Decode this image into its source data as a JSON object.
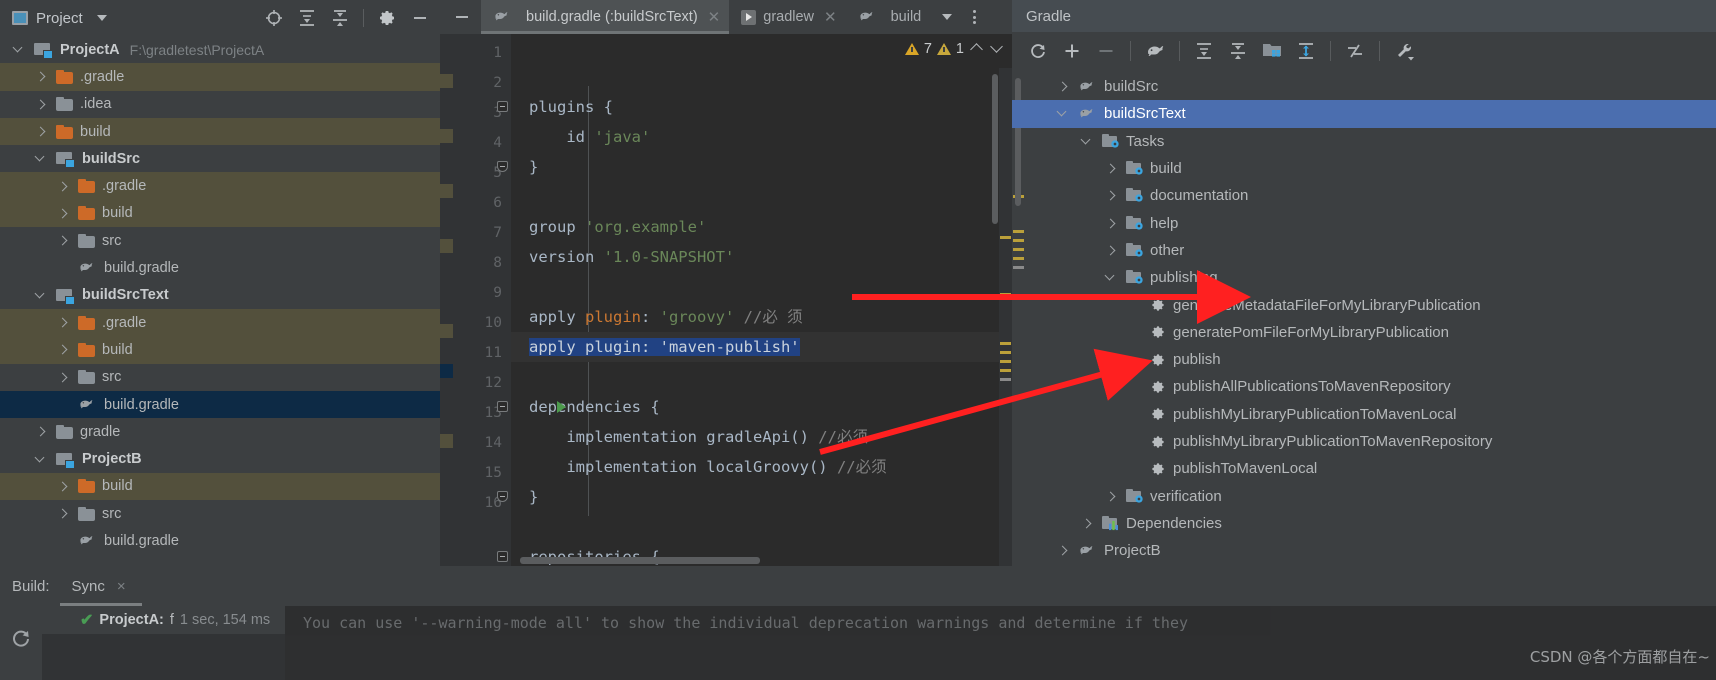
{
  "project_panel": {
    "title": "Project",
    "toolbar_icons": [
      "locate-icon",
      "expand-all-icon",
      "collapse-all-icon",
      "settings-gear-icon",
      "minimize-icon"
    ],
    "tree": [
      {
        "label": "ProjectA",
        "path": "F:\\gradletest\\ProjectA",
        "indent": 0,
        "arrow": "down",
        "icon": "module-folder-icon",
        "bold": true,
        "row_style": "dark"
      },
      {
        "label": ".gradle",
        "indent": 1,
        "arrow": "right",
        "icon": "folder-orange-icon",
        "row_style": "brown"
      },
      {
        "label": ".idea",
        "indent": 1,
        "arrow": "right",
        "icon": "folder-gray-icon",
        "row_style": "dark"
      },
      {
        "label": "build",
        "indent": 1,
        "arrow": "right",
        "icon": "folder-orange-icon",
        "row_style": "brown"
      },
      {
        "label": "buildSrc",
        "indent": 1,
        "arrow": "down",
        "icon": "module-folder-icon",
        "bold": true,
        "row_style": "dark"
      },
      {
        "label": ".gradle",
        "indent": 2,
        "arrow": "right",
        "icon": "folder-orange-icon",
        "row_style": "brown"
      },
      {
        "label": "build",
        "indent": 2,
        "arrow": "right",
        "icon": "folder-orange-icon",
        "row_style": "brown"
      },
      {
        "label": "src",
        "indent": 2,
        "arrow": "right",
        "icon": "folder-gray-icon",
        "row_style": "dark"
      },
      {
        "label": "build.gradle",
        "indent": 2,
        "arrow": "none",
        "icon": "gradle-elephant-icon",
        "row_style": "dark"
      },
      {
        "label": "buildSrcText",
        "indent": 1,
        "arrow": "down",
        "icon": "module-folder-icon",
        "bold": true,
        "row_style": "dark"
      },
      {
        "label": ".gradle",
        "indent": 2,
        "arrow": "right",
        "icon": "folder-orange-icon",
        "row_style": "brown"
      },
      {
        "label": "build",
        "indent": 2,
        "arrow": "right",
        "icon": "folder-orange-icon",
        "row_style": "brown"
      },
      {
        "label": "src",
        "indent": 2,
        "arrow": "right",
        "icon": "folder-gray-icon",
        "row_style": "dark"
      },
      {
        "label": "build.gradle",
        "indent": 2,
        "arrow": "none",
        "icon": "gradle-elephant-icon",
        "row_style": "selected"
      },
      {
        "label": "gradle",
        "indent": 1,
        "arrow": "right",
        "icon": "folder-gray-icon",
        "row_style": "dark"
      },
      {
        "label": "ProjectB",
        "indent": 1,
        "arrow": "down",
        "icon": "module-folder-icon",
        "bold": true,
        "row_style": "dark"
      },
      {
        "label": "build",
        "indent": 2,
        "arrow": "right",
        "icon": "folder-orange-icon",
        "row_style": "brown"
      },
      {
        "label": "src",
        "indent": 2,
        "arrow": "right",
        "icon": "folder-gray-icon",
        "row_style": "dark"
      },
      {
        "label": "build.gradle",
        "indent": 2,
        "arrow": "none",
        "icon": "gradle-elephant-icon",
        "row_style": "dark"
      }
    ]
  },
  "editor": {
    "tabs": [
      {
        "label": "build.gradle (:buildSrcText)",
        "icon": "gradle-elephant-icon",
        "active": true,
        "closable": true
      },
      {
        "label": "gradlew",
        "icon": "run-script-icon",
        "active": false,
        "closable": true
      },
      {
        "label": "build",
        "icon": "gradle-elephant-icon",
        "active": false,
        "closable": false
      }
    ],
    "inspection": {
      "warning_count": "7",
      "weak_warning_count": "1",
      "up_label": "previous-highlight",
      "down_label": "next-highlight"
    },
    "line_numbers": [
      "1",
      "2",
      "3",
      "4",
      "5",
      "6",
      "7",
      "8",
      "9",
      "10",
      "11",
      "12",
      "13",
      "14",
      "15",
      "16"
    ],
    "code": [
      {
        "n": 1,
        "tokens": [
          {
            "t": "plugins ",
            "c": "pl"
          },
          {
            "t": "{",
            "c": "pl"
          }
        ],
        "fold": "start"
      },
      {
        "n": 2,
        "tokens": [
          {
            "t": "    id ",
            "c": "pl"
          },
          {
            "t": "'java'",
            "c": "str"
          }
        ]
      },
      {
        "n": 3,
        "tokens": [
          {
            "t": "}",
            "c": "pl"
          }
        ],
        "fold": "end"
      },
      {
        "n": 4,
        "tokens": []
      },
      {
        "n": 5,
        "tokens": [
          {
            "t": "group ",
            "c": "pl"
          },
          {
            "t": "'org.example'",
            "c": "str"
          }
        ]
      },
      {
        "n": 6,
        "tokens": [
          {
            "t": "version ",
            "c": "pl"
          },
          {
            "t": "'1.0-SNAPSHOT'",
            "c": "str"
          }
        ]
      },
      {
        "n": 7,
        "tokens": []
      },
      {
        "n": 8,
        "tokens": [
          {
            "t": "apply ",
            "c": "pl"
          },
          {
            "t": "plugin",
            "c": "kw"
          },
          {
            "t": ": ",
            "c": "pl"
          },
          {
            "t": "'groovy'",
            "c": "str"
          },
          {
            "t": " //必 须",
            "c": "cmt"
          }
        ]
      },
      {
        "n": 9,
        "selected": true,
        "sel_text": "apply plugin: 'maven-publish'",
        "tokens": [
          {
            "t": "apply ",
            "c": "pl"
          },
          {
            "t": "plugin",
            "c": "kw"
          },
          {
            "t": ": ",
            "c": "pl"
          },
          {
            "t": "'maven-publish'",
            "c": "str"
          }
        ]
      },
      {
        "n": 10,
        "tokens": []
      },
      {
        "n": 11,
        "tokens": [
          {
            "t": "dependencies ",
            "c": "pl"
          },
          {
            "t": "{",
            "c": "pl"
          }
        ],
        "fold": "start",
        "runnable": true
      },
      {
        "n": 12,
        "tokens": [
          {
            "t": "    implementation gradleApi() ",
            "c": "pl"
          },
          {
            "t": "//必须",
            "c": "cmt"
          }
        ]
      },
      {
        "n": 13,
        "tokens": [
          {
            "t": "    implementation localGroovy() ",
            "c": "pl"
          },
          {
            "t": "//必须",
            "c": "cmt"
          }
        ]
      },
      {
        "n": 14,
        "tokens": [
          {
            "t": "}",
            "c": "pl"
          }
        ],
        "fold": "end"
      },
      {
        "n": 15,
        "tokens": []
      },
      {
        "n": 16,
        "tokens": [
          {
            "t": "repositories ",
            "c": "pl"
          },
          {
            "t": "{",
            "c": "pl"
          }
        ],
        "fold": "start"
      }
    ]
  },
  "gradle_panel": {
    "title": "Gradle",
    "toolbar_icons": [
      "refresh-icon",
      "add-icon",
      "remove-icon",
      "execute-gradle-task-icon",
      "expand-all-icon",
      "collapse-all-icon",
      "show-projects-icon",
      "toggle-offline-icon",
      "skip-tests-icon",
      "build-tool-settings-icon"
    ],
    "tree": [
      {
        "label": "buildSrc",
        "indent": 1,
        "arrow": "right",
        "icon": "gradle-elephant-icon"
      },
      {
        "label": "buildSrcText",
        "indent": 1,
        "arrow": "down",
        "icon": "gradle-elephant-icon",
        "selected": true
      },
      {
        "label": "Tasks",
        "indent": 2,
        "arrow": "down",
        "icon": "tasks-folder-icon"
      },
      {
        "label": "build",
        "indent": 3,
        "arrow": "right",
        "icon": "tasks-folder-icon"
      },
      {
        "label": "documentation",
        "indent": 3,
        "arrow": "right",
        "icon": "tasks-folder-icon"
      },
      {
        "label": "help",
        "indent": 3,
        "arrow": "right",
        "icon": "tasks-folder-icon"
      },
      {
        "label": "other",
        "indent": 3,
        "arrow": "right",
        "icon": "tasks-folder-icon"
      },
      {
        "label": "publishing",
        "indent": 3,
        "arrow": "down",
        "icon": "tasks-folder-icon"
      },
      {
        "label": "generateMetadataFileForMyLibraryPublication",
        "indent": 4,
        "arrow": "none",
        "icon": "gear-task-icon"
      },
      {
        "label": "generatePomFileForMyLibraryPublication",
        "indent": 4,
        "arrow": "none",
        "icon": "gear-task-icon"
      },
      {
        "label": "publish",
        "indent": 4,
        "arrow": "none",
        "icon": "gear-task-icon"
      },
      {
        "label": "publishAllPublicationsToMavenRepository",
        "indent": 4,
        "arrow": "none",
        "icon": "gear-task-icon"
      },
      {
        "label": "publishMyLibraryPublicationToMavenLocal",
        "indent": 4,
        "arrow": "none",
        "icon": "gear-task-icon"
      },
      {
        "label": "publishMyLibraryPublicationToMavenRepository",
        "indent": 4,
        "arrow": "none",
        "icon": "gear-task-icon"
      },
      {
        "label": "publishToMavenLocal",
        "indent": 4,
        "arrow": "none",
        "icon": "gear-task-icon"
      },
      {
        "label": "verification",
        "indent": 3,
        "arrow": "right",
        "icon": "tasks-folder-icon"
      },
      {
        "label": "Dependencies",
        "indent": 2,
        "arrow": "right",
        "icon": "dependencies-icon"
      },
      {
        "label": "ProjectB",
        "indent": 1,
        "arrow": "right",
        "icon": "gradle-elephant-icon"
      }
    ]
  },
  "build_bar": {
    "label": "Build:",
    "tab": "Sync",
    "close": "×",
    "result_name": "ProjectA:",
    "result_status": "f",
    "result_duration": "1 sec, 154 ms",
    "check": "✔"
  },
  "console": {
    "line": "You can use '--warning-mode all' to show the individual deprecation warnings and determine if they"
  },
  "watermark": "CSDN @各个方面都自在~"
}
